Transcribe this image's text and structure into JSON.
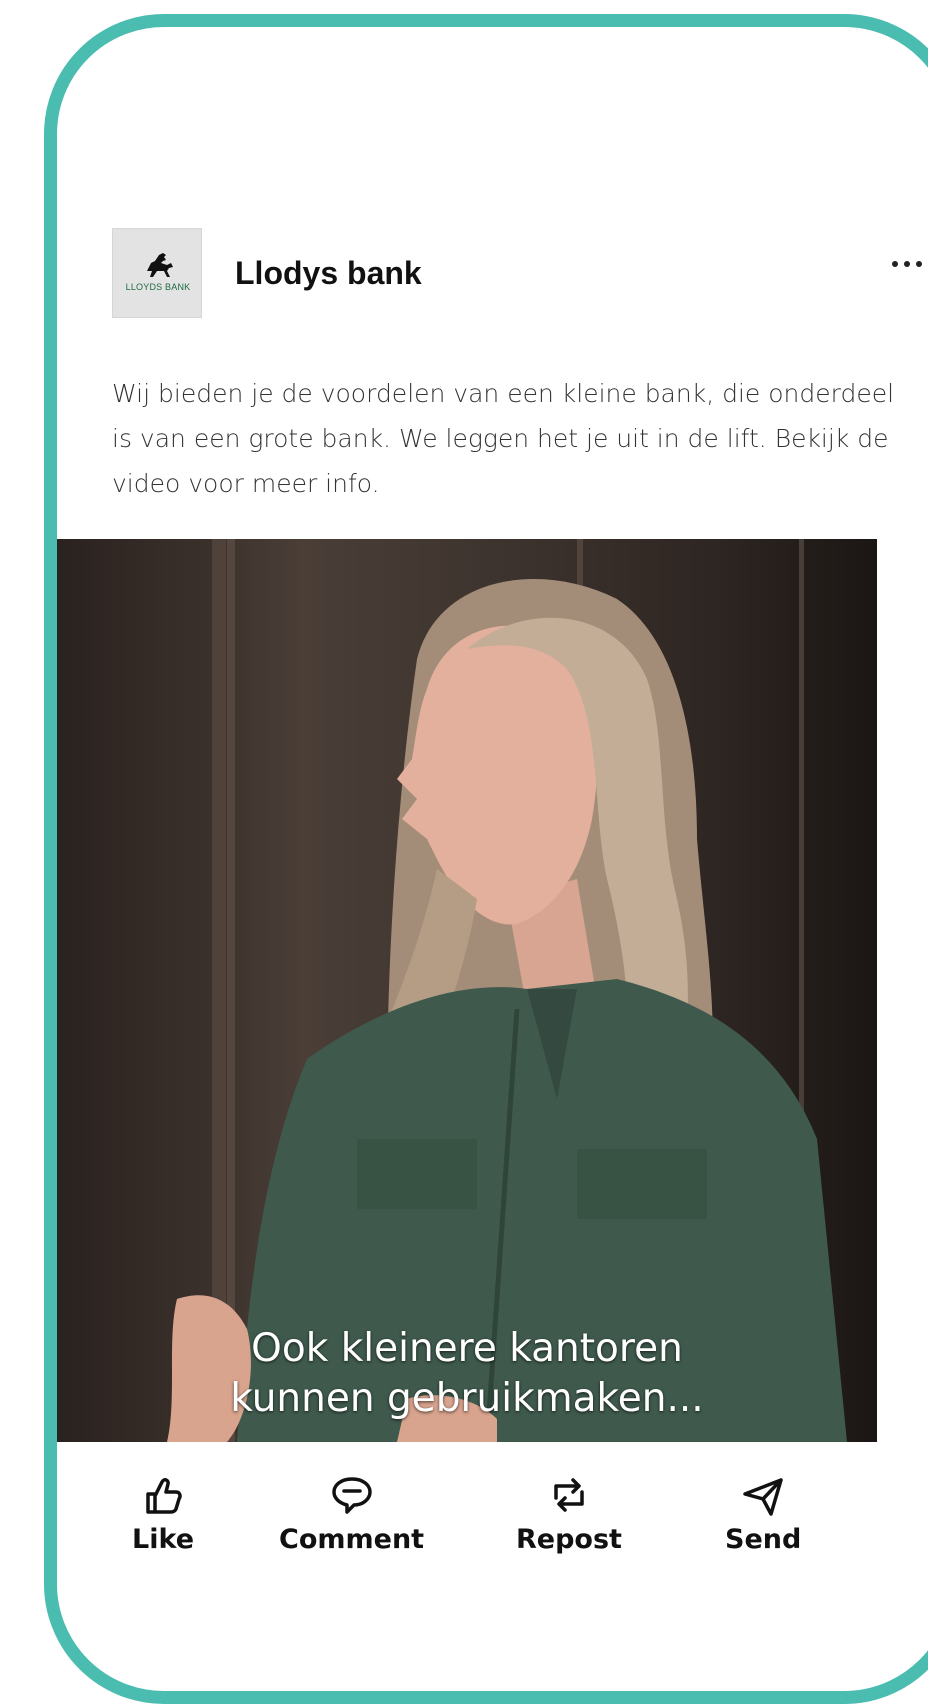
{
  "post": {
    "account_name": "Llodys bank",
    "avatar_logo_text": "LLOYDS BANK",
    "caption": "Wij bieden je de voordelen van een kleine bank, die onderdeel is van een grote bank. We leggen het je uit in de lift. Bekijk de video voor meer info.",
    "video_subtitle_line1": "Ook kleinere kantoren",
    "video_subtitle_line2": "kunnen gebruikmaken..."
  },
  "actions": {
    "like": "Like",
    "comment": "Comment",
    "repost": "Repost",
    "send": "Send"
  },
  "icons": {
    "more": "more-horizontal-icon",
    "like": "thumbs-up-icon",
    "comment": "speech-bubble-icon",
    "repost": "repost-arrows-icon",
    "send": "paper-plane-icon",
    "logo": "black-horse-icon"
  },
  "colors": {
    "frame": "#4bbdb0",
    "logo_green": "#1d6b44",
    "shirt": "#3f5a4d",
    "hair": "#b8a08a"
  }
}
